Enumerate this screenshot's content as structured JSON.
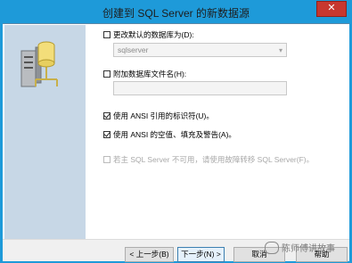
{
  "window": {
    "title": "创建到 SQL Server 的新数据源",
    "close_glyph": "✕"
  },
  "options": {
    "change_default_db": {
      "label": "更改默认的数据库为(D):",
      "checked": false,
      "dropdown_value": "sqlserver"
    },
    "attach_db_file": {
      "label": "附加数据库文件名(H):",
      "checked": false,
      "value": ""
    },
    "ansi_quoted_identifiers": {
      "label": "使用 ANSI 引用的标识符(U)。",
      "checked": true
    },
    "ansi_nulls_padding_warnings": {
      "label": "使用 ANSI 的空值、填充及警告(A)。",
      "checked": true
    },
    "failover": {
      "label": "若主 SQL Server 不可用，请使用故障转移 SQL Server(F)。",
      "checked": false,
      "disabled": true
    }
  },
  "buttons": {
    "back": "< 上一步(B)",
    "next": "下一步(N) >",
    "cancel": "取消",
    "help": "帮助"
  },
  "watermark": {
    "text": "陈师傅讲故事"
  },
  "colors": {
    "title_bar": "#1e9ad9",
    "close_button": "#c7372f",
    "side_panel": "#c7d7e6"
  }
}
